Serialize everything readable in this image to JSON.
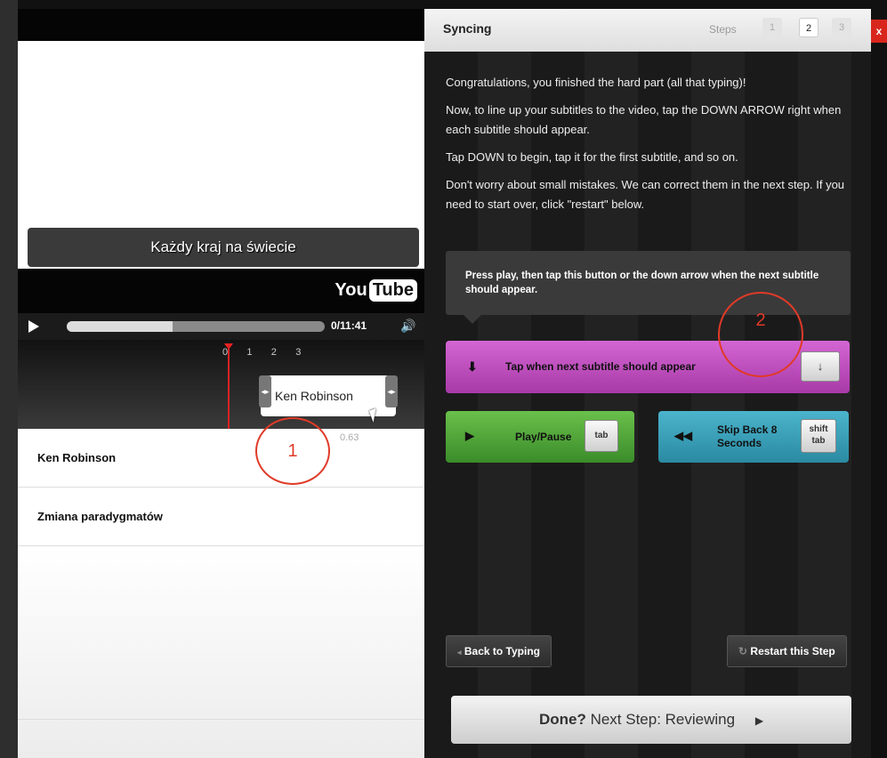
{
  "video": {
    "caption": "Każdy kraj na świecie",
    "logo_you": "You",
    "logo_tube": "Tube",
    "time": "0/11:41",
    "progress_fraction": 0.41
  },
  "timeline": {
    "ruler_text": "0     1     2     3",
    "chip_label": "Ken Robinson",
    "chip_time": "0.63"
  },
  "subtitles": [
    {
      "text": "Ken Robinson"
    },
    {
      "text": "Zmiana paradygmatów"
    }
  ],
  "annotations": {
    "first": "1",
    "second": "2"
  },
  "panel": {
    "title": "Syncing",
    "steps_label": "Steps",
    "steps": [
      "1",
      "2",
      "3"
    ],
    "active_step": "2",
    "close": "x",
    "instructions": [
      "Congratulations, you finished the hard part (all that typing)!",
      "Now, to line up your subtitles to the video, tap the DOWN ARROW right when each subtitle should appear.",
      "Tap DOWN to begin, tap it for the first subtitle, and so on.",
      "Don't worry about small mistakes. We can correct them in the next step. If you need to start over, click \"restart\" below."
    ],
    "tooltip": "Press play, then tap this button or the down arrow when the next subtitle should appear.",
    "tap_button": "Tap when next subtitle should appear",
    "tap_key": "↓",
    "play_button": "Play/Pause",
    "play_key": "tab",
    "skip_button": "Skip Back 8 Seconds",
    "skip_key_top": "shift",
    "skip_key_bottom": "tab",
    "back_button": "Back to Typing",
    "restart_button": "Restart this Step",
    "done_strong": "Done?",
    "done_rest": "Next Step: Reviewing"
  },
  "colors": {
    "tap": "#b84cb8",
    "play": "#4fa63a",
    "skip": "#3aa0b8",
    "annotation": "#e03a28",
    "close": "#d8261c"
  }
}
